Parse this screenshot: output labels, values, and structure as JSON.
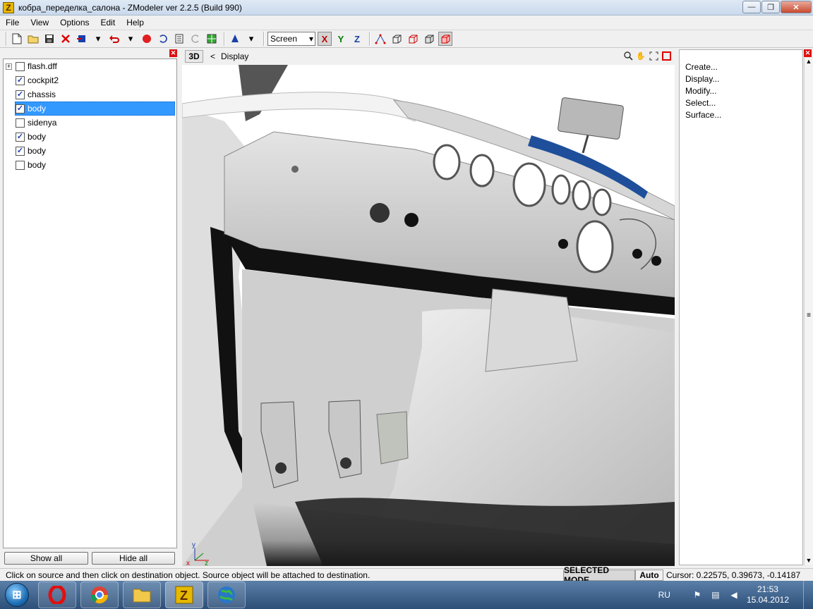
{
  "window": {
    "title": "кобра_переделка_салона - ZModeler ver 2.2.5 (Build 990)",
    "app_icon": "Z",
    "controls": {
      "minimize": "—",
      "maximize": "❐",
      "close": "✕"
    }
  },
  "menubar": {
    "items": [
      "File",
      "View",
      "Options",
      "Edit",
      "Help"
    ]
  },
  "toolbar": {
    "view_select": "Screen",
    "axes": {
      "x": "X",
      "y": "Y",
      "z": "Z"
    }
  },
  "left_panel": {
    "tree": [
      {
        "label": "flash.dff",
        "checked": false,
        "expandable": true,
        "selected": false
      },
      {
        "label": "cockpit2",
        "checked": true,
        "expandable": false,
        "selected": false
      },
      {
        "label": "chassis",
        "checked": true,
        "expandable": false,
        "selected": false
      },
      {
        "label": "body",
        "checked": true,
        "expandable": false,
        "selected": true
      },
      {
        "label": "sidenya",
        "checked": false,
        "expandable": false,
        "selected": false
      },
      {
        "label": "body",
        "checked": true,
        "expandable": false,
        "selected": false
      },
      {
        "label": "body",
        "checked": true,
        "expandable": false,
        "selected": false
      },
      {
        "label": "body",
        "checked": false,
        "expandable": false,
        "selected": false
      }
    ],
    "show_all": "Show all",
    "hide_all": "Hide all"
  },
  "viewport": {
    "mode": "3D",
    "nav": "<",
    "title": "Display",
    "axis_labels": {
      "x": "x",
      "y": "y",
      "z": "z"
    }
  },
  "right_panel": {
    "items": [
      "Create...",
      "Display...",
      "Modify...",
      "Select...",
      "Surface..."
    ]
  },
  "statusbar": {
    "message": "Click on source and then click on destination object. Source object will be attached to destination.",
    "mode": "SELECTED MODE",
    "auto": "Auto",
    "cursor": "Cursor: 0.22575, 0.39673, -0.14187"
  },
  "taskbar": {
    "lang": "RU",
    "time": "21:53",
    "date": "15.04.2012"
  }
}
